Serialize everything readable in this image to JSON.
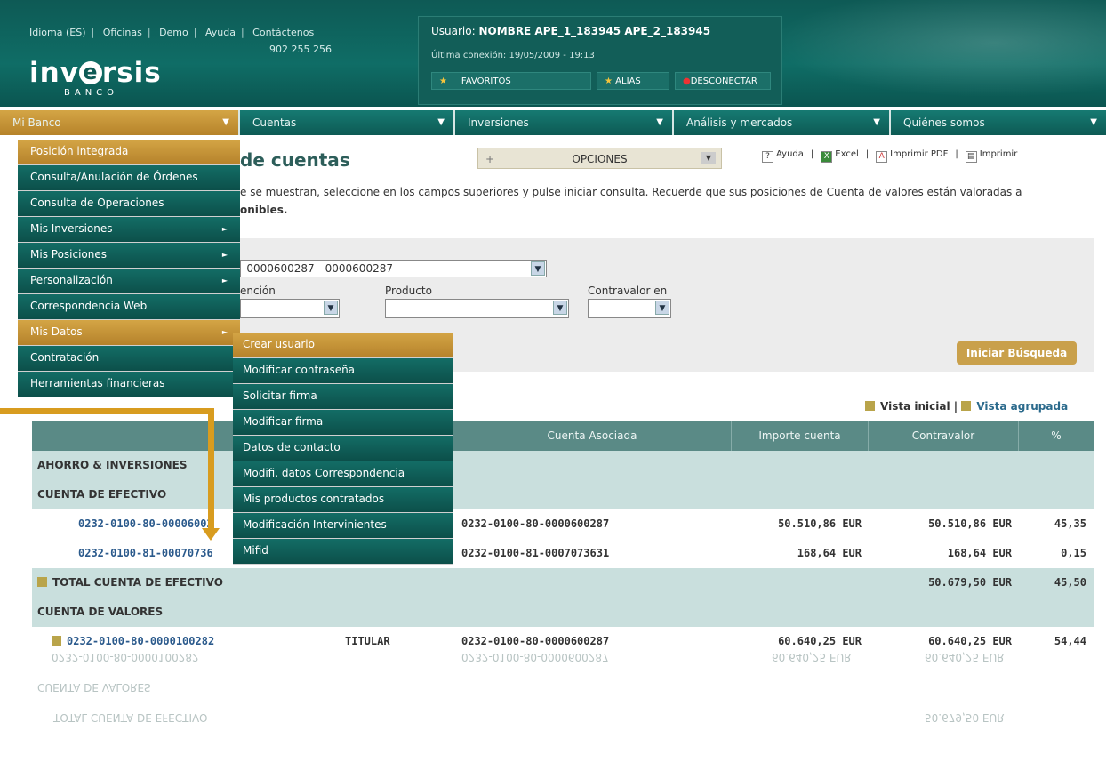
{
  "header": {
    "links": [
      "Idioma (ES)",
      "Oficinas",
      "Demo",
      "Ayuda",
      "Contáctenos"
    ],
    "phone": "902 255 256",
    "logo_text": "inversis",
    "logo_sub": "BANCO",
    "user_label": "Usuario:",
    "user_name": "NOMBRE APE_1_183945 APE_2_183945",
    "last_connection": "Última conexión: 19/05/2009 - 19:13",
    "buttons": [
      "FAVORITOS",
      "ALIAS",
      "DESCONECTAR"
    ]
  },
  "nav": {
    "tabs": [
      "Mi Banco",
      "Cuentas",
      "Inversiones",
      "Análisis y mercados",
      "Quiénes somos"
    ]
  },
  "menu": {
    "items": [
      "Posición integrada",
      "Consulta/Anulación de Órdenes",
      "Consulta de Operaciones",
      "Mis Inversiones",
      "Mis Posiciones",
      "Personalización",
      "Correspondencia Web",
      "Mis Datos",
      "Contratación",
      "Herramientas financieras"
    ],
    "submenu": [
      "Crear usuario",
      "Modificar contraseña",
      "Solicitar firma",
      "Modificar firma",
      "Datos de contacto",
      "Modifi. datos Correspondencia",
      "Mis productos contratados",
      "Modificación Intervinientes",
      "Mifid"
    ]
  },
  "page": {
    "title": "de cuentas",
    "opciones": "OPCIONES",
    "tools": [
      "Ayuda",
      "Excel",
      "Imprimir PDF",
      "Imprimir"
    ],
    "description": "e se muestran, seleccione en los campos superiores y pulse iniciar consulta. Recuerde que sus posiciones de Cuenta de valores están valoradas a",
    "description2": "onibles.",
    "account_select": "-0000600287 - 0000600287",
    "filter_labels": [
      "ención",
      "Producto",
      "Contravalor en"
    ],
    "search_button": "Iniciar Búsqueda",
    "view_initial": "Vista inicial",
    "view_grouped": "Vista agrupada"
  },
  "table": {
    "headers": [
      "Cuenta Asociada",
      "Importe cuenta",
      "Contravalor",
      "%"
    ],
    "section_1": "AHORRO & INVERSIONES",
    "section_2": "CUENTA DE EFECTIVO",
    "rows_efectivo": [
      {
        "account": "0232-0100-80-00006002",
        "assoc": "0232-0100-80-0000600287",
        "amount": "50.510,86 EUR",
        "counter": "50.510,86 EUR",
        "pct": "45,35"
      },
      {
        "account": "0232-0100-81-00070736",
        "assoc": "0232-0100-81-0007073631",
        "amount": "168,64 EUR",
        "counter": "168,64 EUR",
        "pct": "0,15"
      }
    ],
    "total_efectivo": {
      "label": "TOTAL CUENTA DE EFECTIVO",
      "counter": "50.679,50 EUR",
      "pct": "45,50"
    },
    "section_3": "CUENTA DE VALORES",
    "row_valores": {
      "account": "0232-0100-80-0000100282",
      "role": "TITULAR",
      "assoc": "0232-0100-80-0000600287",
      "amount": "60.640,25 EUR",
      "counter": "60.640,25 EUR",
      "pct": "54,44"
    }
  }
}
